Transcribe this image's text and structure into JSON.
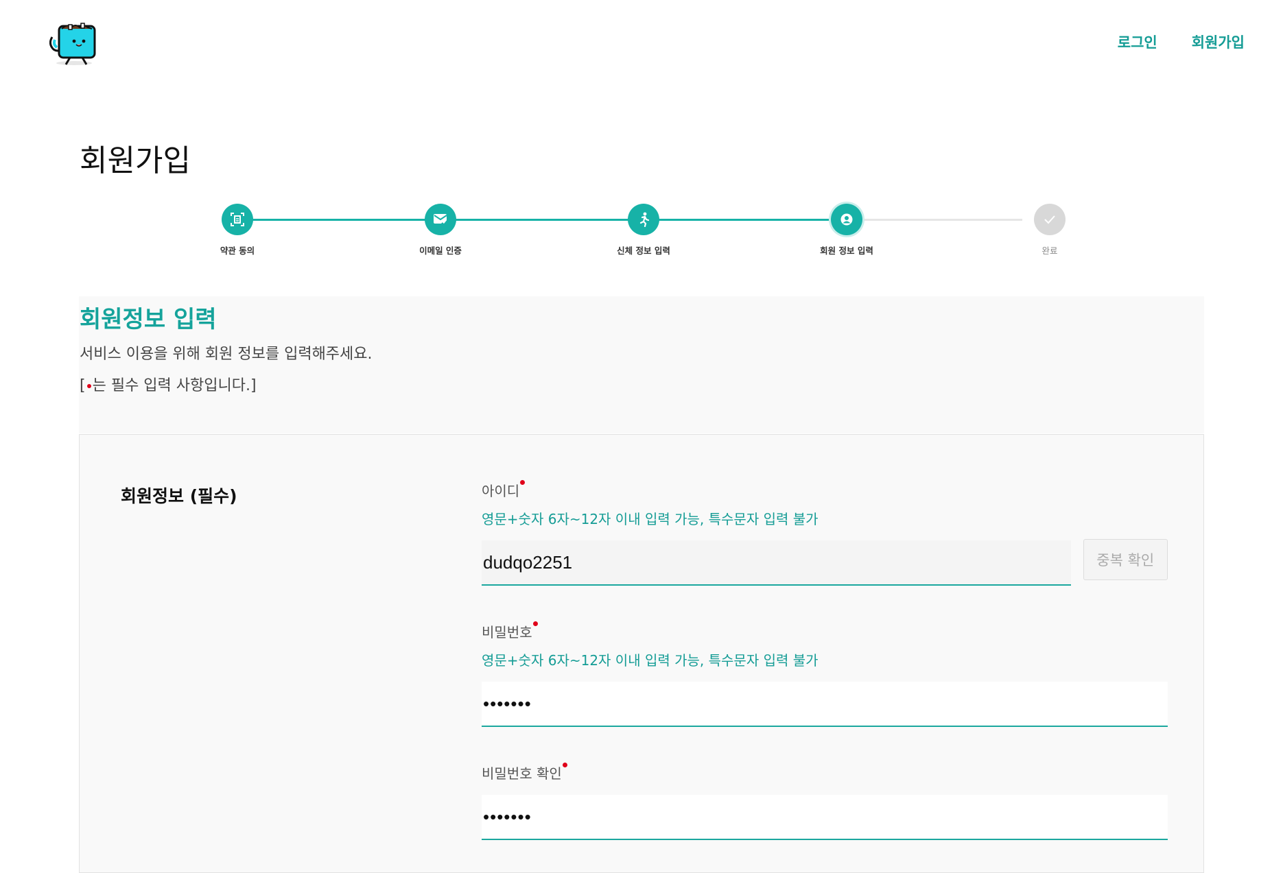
{
  "header": {
    "logo_icon": "coffee-mug-mascot-icon",
    "nav": {
      "login": "로그인",
      "signup": "회원가입"
    }
  },
  "page_title": "회원가입",
  "stepper": {
    "active_color": "#17b2a7",
    "steps": [
      {
        "label": "약관 동의",
        "icon": "document-scan-icon",
        "state": "done"
      },
      {
        "label": "이메일 인증",
        "icon": "mail-check-icon",
        "state": "done"
      },
      {
        "label": "신체 정보 입력",
        "icon": "running-person-icon",
        "state": "done"
      },
      {
        "label": "회원 정보 입력",
        "icon": "user-circle-icon",
        "state": "current"
      },
      {
        "label": "완료",
        "icon": "check-icon",
        "state": "pending"
      }
    ]
  },
  "intro": {
    "title": "회원정보 입력",
    "description": "서비스 이용을 위해 회원 정보를 입력해주세요.",
    "note_prefix": "[",
    "note_suffix": "는 필수 입력 사항입니다.]"
  },
  "form": {
    "section_label": "회원정보 (필수)",
    "id_field": {
      "label": "아이디",
      "hint": "영문+숫자 6자~12자 이내 입력 가능, 특수문자 입력 불가",
      "value": "dudqo2251",
      "check_button": "중복 확인"
    },
    "password_field": {
      "label": "비밀번호",
      "hint": "영문+숫자 6자~12자 이내 입력 가능, 특수문자 입력 불가",
      "value": "•••••••"
    },
    "password_confirm_field": {
      "label": "비밀번호 확인",
      "value": "•••••••"
    }
  }
}
